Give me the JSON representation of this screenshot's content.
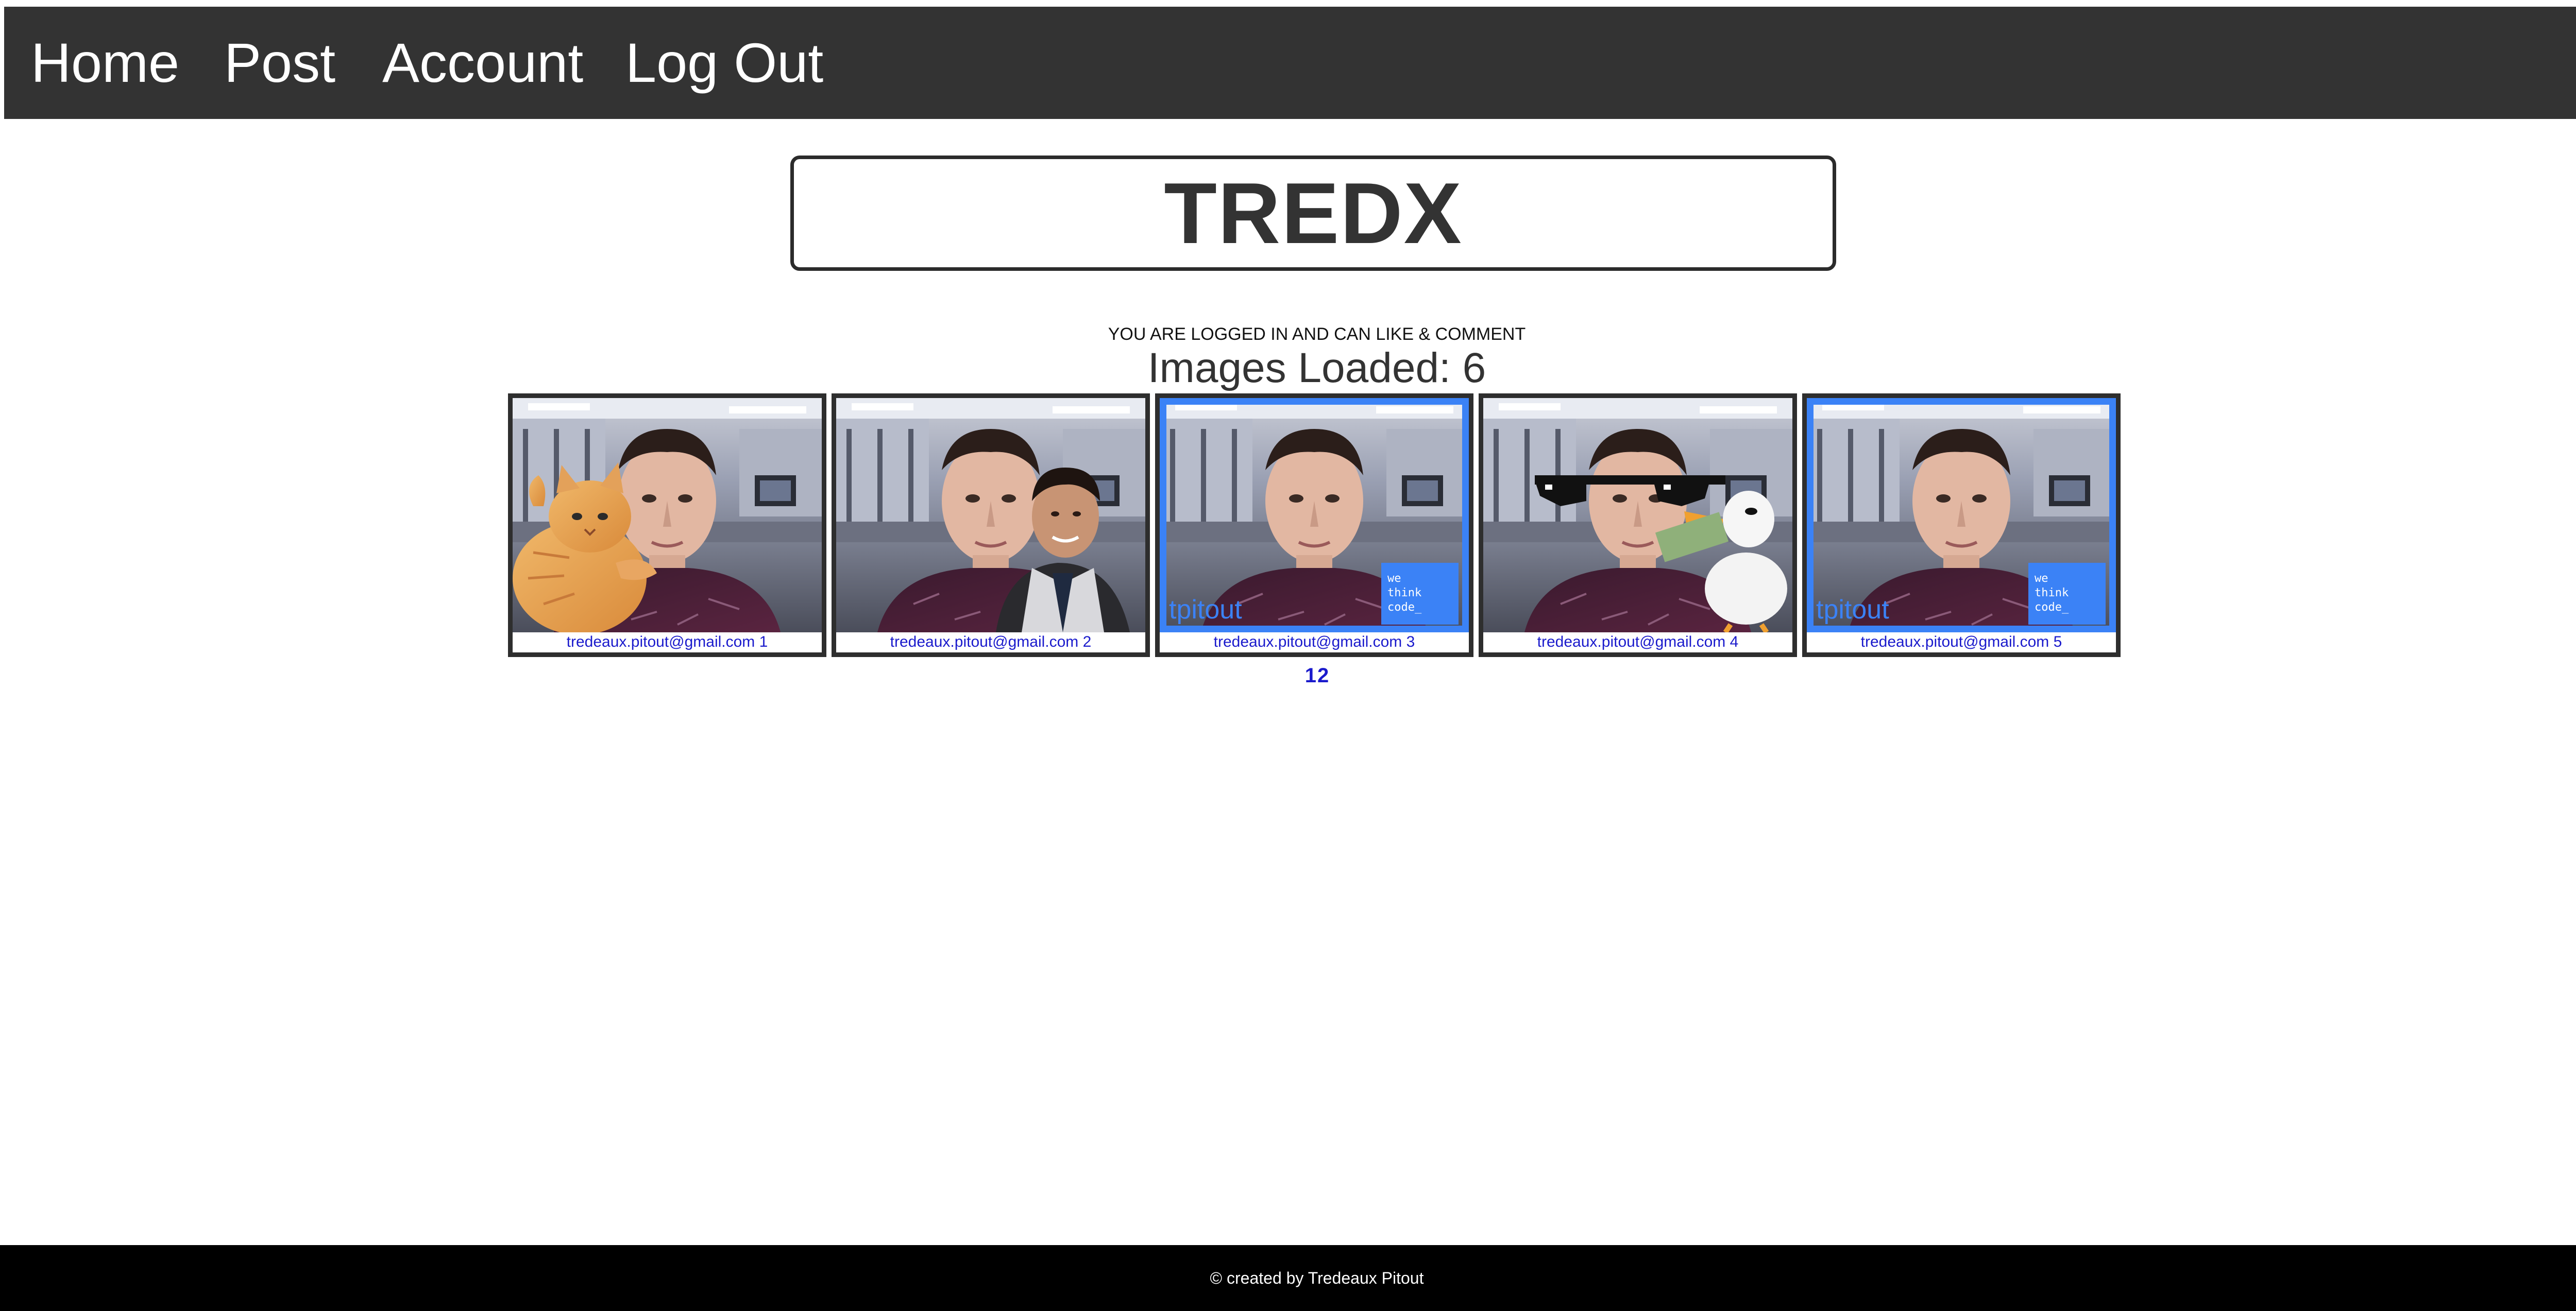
{
  "nav": {
    "home": "Home",
    "post": "Post",
    "account": "Account",
    "logout": "Log Out"
  },
  "header": {
    "title": "TREDX"
  },
  "status": {
    "message": "YOU ARE LOGGED IN AND CAN LIKE & COMMENT",
    "images_loaded": "Images Loaded: 6"
  },
  "gallery": {
    "items": [
      {
        "caption": "tredeaux.pitout@gmail.com 1",
        "overlay": "cat-sticker"
      },
      {
        "caption": "tredeaux.pitout@gmail.com 2",
        "overlay": "person-sticker"
      },
      {
        "caption": "tredeaux.pitout@gmail.com 3",
        "overlay": "tpitout-wethinkcode-frame",
        "watermark": "tpitout",
        "badge": [
          "we",
          "think",
          "code_"
        ]
      },
      {
        "caption": "tredeaux.pitout@gmail.com 4",
        "overlay": "sunglasses-duck-sticker"
      },
      {
        "caption": "tredeaux.pitout@gmail.com 5",
        "overlay": "tpitout-wethinkcode-frame",
        "watermark": "tpitout",
        "badge": [
          "we",
          "think",
          "code_"
        ]
      }
    ]
  },
  "pagination": {
    "pages": [
      "1",
      "2"
    ]
  },
  "footer": {
    "text": "© created by Tredeaux Pitout"
  },
  "colors": {
    "navbar": "#333333",
    "link": "#1a1acc",
    "frame_accent": "#3b82f6",
    "footer": "#000000"
  }
}
